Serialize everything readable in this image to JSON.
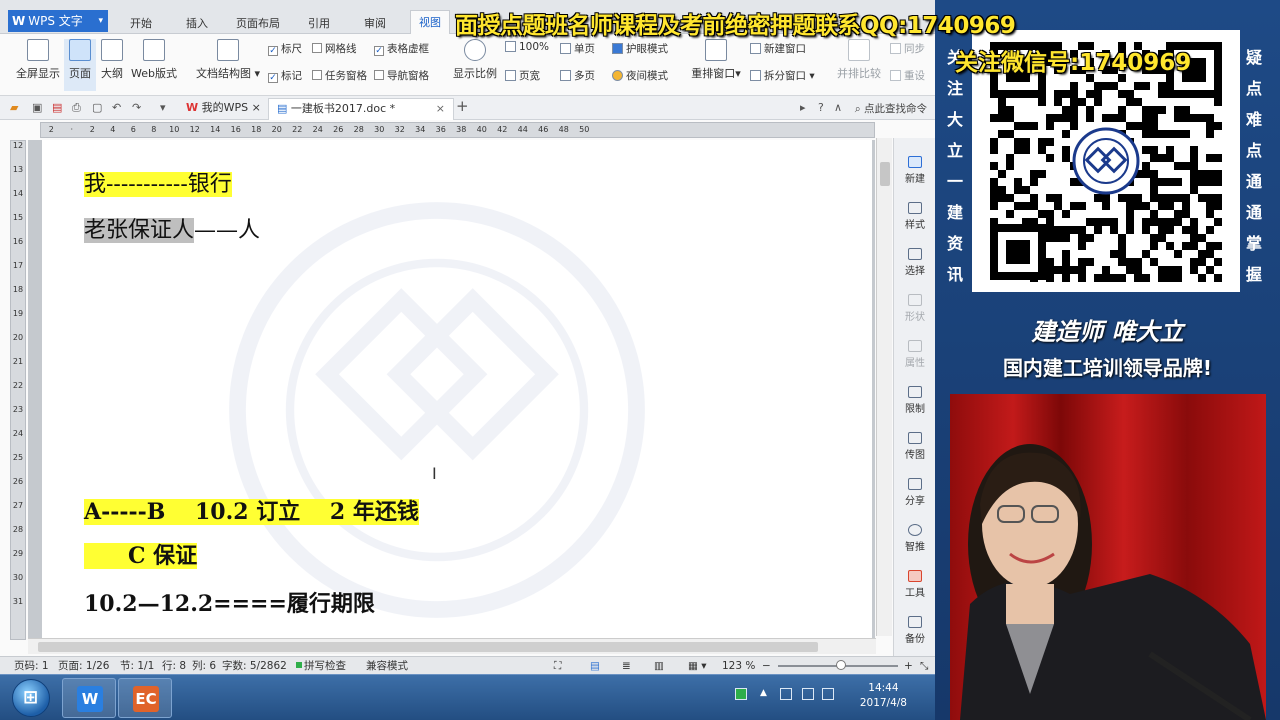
{
  "app": {
    "name": "WPS 文字",
    "tabs": [
      "开始",
      "插入",
      "页面布局",
      "引用",
      "审阅",
      "视图"
    ],
    "active_tab": "视图"
  },
  "ribbon": {
    "fullscreen": "全屏显示",
    "page": "页面",
    "outline": "大纲",
    "web": "Web版式",
    "doc_structure": "文档结构图",
    "ruler": "标尺",
    "gridlines": "网格线",
    "table_gridlines": "表格虚框",
    "marks": "标记",
    "task_pane": "任务窗格",
    "nav_pane": "导航窗格",
    "zoom": "显示比例",
    "pct100": "100%",
    "page_width": "页宽",
    "single_page": "单页",
    "multi_page": "多页",
    "eye_mode": "护眼模式",
    "night_mode": "夜间模式",
    "rearrange": "重排窗口",
    "new_window": "新建窗口",
    "split_window": "拆分窗口",
    "compare": "并排比较",
    "sync": "同步",
    "reset": "重设"
  },
  "doc_tabs": {
    "home": "我的WPS",
    "doc": "一建板书2017.doc *"
  },
  "find_command": "点此查找命令",
  "ruler_marks": [
    "2",
    "",
    "2",
    "4",
    "6",
    "8",
    "10",
    "12",
    "14",
    "16",
    "18",
    "20",
    "22",
    "24",
    "26",
    "28",
    "30",
    "32",
    "34",
    "36",
    "38",
    "40",
    "42",
    "44",
    "46",
    "48",
    "50"
  ],
  "vruler_marks": [
    "12",
    "13",
    "14",
    "15",
    "16",
    "17",
    "18",
    "19",
    "20",
    "21",
    "22",
    "23",
    "24",
    "25",
    "26",
    "27",
    "28",
    "29",
    "30",
    "31"
  ],
  "document": {
    "line1": "我-----------银行",
    "line2_part1": "老张保证人",
    "line2_part2": "——人",
    "line3": "A-----B　 10.2 订立　 2 年还钱",
    "line4": "　　C 保证",
    "line5": "10.2—12.2====履行期限"
  },
  "right_panel": [
    "新建",
    "样式",
    "选择",
    "形状",
    "属性",
    "限制",
    "传图",
    "分享",
    "智推",
    "工具",
    "备份"
  ],
  "status": {
    "page_num": "页码: 1",
    "pages": "页面: 1/26",
    "section": "节: 1/1",
    "row": "行: 8",
    "col": "列: 6",
    "words": "字数: 5/2862",
    "spell": "拼写检查",
    "compat": "兼容模式",
    "zoom": "123 %"
  },
  "taskbar": {
    "time": "14:44",
    "date": "2017/4/8"
  },
  "overlay": {
    "banner": "面授点题班名师课程及考前绝密押题联系QQ:1740969",
    "banner2": "关注微信号:1740969",
    "left_vertical": "关注大立一建资讯",
    "right_vertical": "疑点难点通通掌握",
    "slogan1": "建造师 唯大立",
    "slogan2": "国内建工培训领导品牌!"
  },
  "colors": {
    "highlight": "#ffff33",
    "banner": "#ffe62e",
    "accent": "#2a6fd0"
  }
}
